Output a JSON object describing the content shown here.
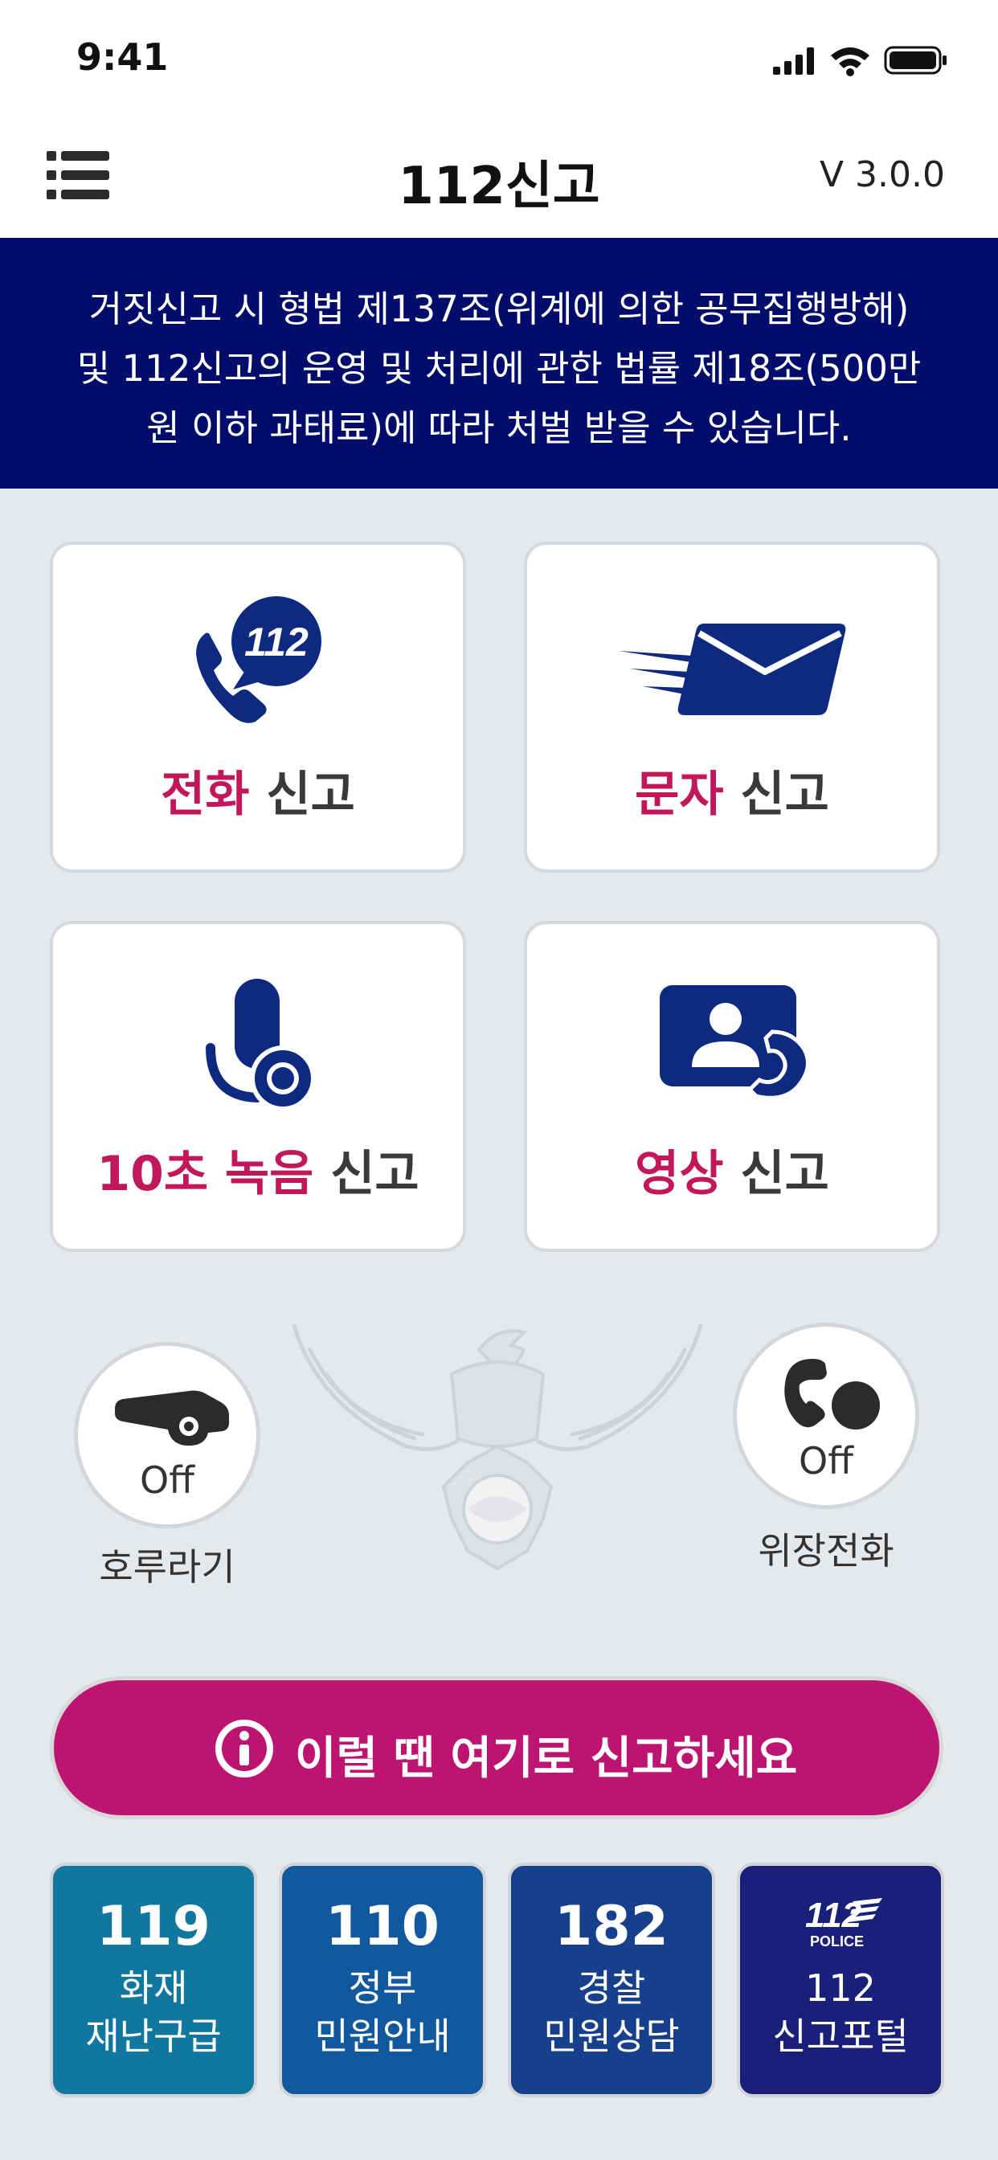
{
  "status_bar": {
    "time": "9:41"
  },
  "app_bar": {
    "title": "112신고",
    "version": "V 3.0.0"
  },
  "notice": {
    "line1": "거짓신고 시 형법 제137조(위계에 의한 공무집행방해)",
    "line2": "및 112신고의 운영 및 처리에 관한 법률 제18조(500만",
    "line3": "원 이하 과태료)에 따라 처벌 받을 수 있습니다."
  },
  "report_cards": [
    {
      "emphasis": "전화",
      "rest": " 신고",
      "icon": "phone-112-icon"
    },
    {
      "emphasis": "문자",
      "rest": " 신고",
      "icon": "envelope-icon"
    },
    {
      "emphasis": "10초 녹음",
      "rest": " 신고",
      "icon": "microphone-icon"
    },
    {
      "emphasis": "영상",
      "rest": " 신고",
      "icon": "video-call-icon"
    }
  ],
  "whistle": {
    "state": "Off",
    "label": "호루라기"
  },
  "fake_call": {
    "state": "Off",
    "label": "위장전화"
  },
  "report_here_button": {
    "label": "이럴 땐 여기로 신고하세요"
  },
  "quick_tiles": [
    {
      "number": "119",
      "line1": "화재",
      "line2": "재난구급",
      "color": "#11779f"
    },
    {
      "number": "110",
      "line1": "정부",
      "line2": "민원안내",
      "color": "#11589f"
    },
    {
      "number": "182",
      "line1": "경찰",
      "line2": "민원상담",
      "color": "#163f8c"
    },
    {
      "logo_text": "112",
      "logo_sub": "POLICE",
      "line1": "112",
      "line2": "신고포털",
      "color": "#18207a"
    }
  ],
  "colors": {
    "navy": "#020c6b",
    "accent_magenta": "#c2185b",
    "icon_blue": "#0d2a80",
    "button_magenta": "#bd1472"
  }
}
